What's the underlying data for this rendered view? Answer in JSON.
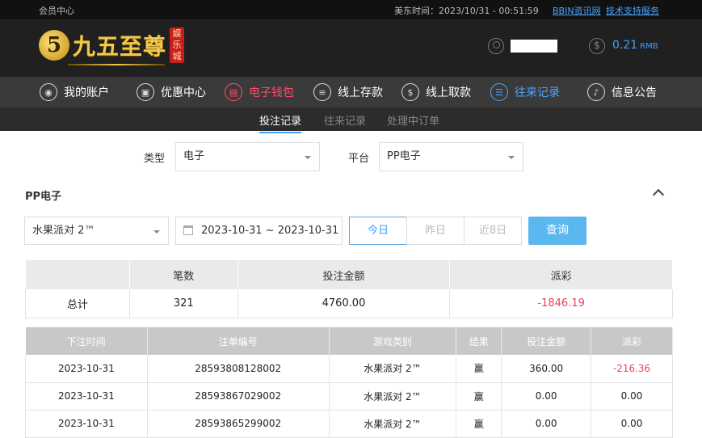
{
  "topbar": {
    "member_center": "会员中心",
    "us_east_time": "美东时间：2023/10/31 - 00:51:59",
    "bbin_news": "BBIN资讯网",
    "tech_support": "技术支持服务"
  },
  "brand": {
    "logo_mark": "5",
    "name": "九五至尊",
    "badge": "娱乐城"
  },
  "account": {
    "balance": "0.21",
    "currency": "RMB"
  },
  "nav": {
    "items": [
      {
        "label": "我的账户",
        "icon": "user-icon"
      },
      {
        "label": "优惠中心",
        "icon": "gift-icon"
      },
      {
        "label": "电子钱包",
        "icon": "wallet-icon"
      },
      {
        "label": "线上存款",
        "icon": "deposit-icon"
      },
      {
        "label": "线上取款",
        "icon": "withdraw-icon"
      },
      {
        "label": "往来记录",
        "icon": "records-icon"
      },
      {
        "label": "信息公告",
        "icon": "bell-icon"
      }
    ]
  },
  "subnav": {
    "tabs": [
      "投注记录",
      "往来记录",
      "处理中订单"
    ],
    "active": "投注记录"
  },
  "filters": {
    "type_label": "类型",
    "type_value": "电子",
    "platform_label": "平台",
    "platform_value": "PP电子",
    "section_title": "PP电子",
    "game_value": "水果派对 2™",
    "date_range": "2023-10-31 ~ 2023-10-31",
    "quick_ranges": [
      "今日",
      "昨日",
      "近8日"
    ],
    "query_label": "查询"
  },
  "summary": {
    "headers": [
      "",
      "笔数",
      "投注金额",
      "派彩"
    ],
    "row": [
      "总计",
      "321",
      "4760.00",
      "-1846.19"
    ]
  },
  "detail": {
    "headers": [
      "下注时间",
      "注单编号",
      "游戏类别",
      "结果",
      "投注金额",
      "派彩"
    ],
    "rows": [
      [
        "2023-10-31",
        "28593808128002",
        "水果派对 2™",
        "赢",
        "360.00",
        "-216.36"
      ],
      [
        "2023-10-31",
        "28593867029002",
        "水果派对 2™",
        "赢",
        "0.00",
        "0.00"
      ],
      [
        "2023-10-31",
        "28593865299002",
        "水果派对 2™",
        "赢",
        "0.00",
        "0.00"
      ]
    ]
  },
  "colors": {
    "accent_blue": "#3ea0ff",
    "accent_red": "#ff4d6a",
    "negative": "#e2475a",
    "query_button": "#5bb8ef"
  }
}
